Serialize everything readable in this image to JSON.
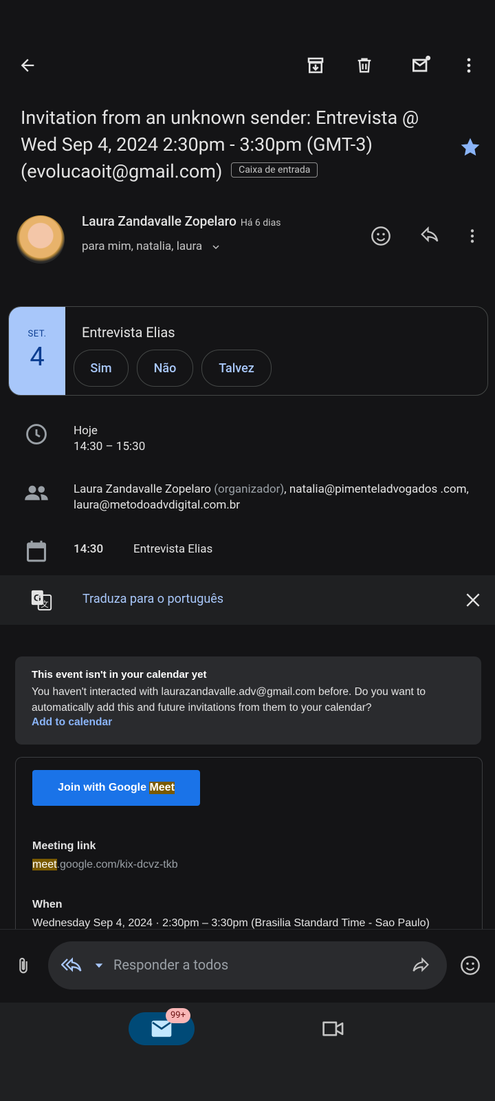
{
  "subject": {
    "text": "Invitation from an unknown sender: Entrevista @ Wed Sep 4, 2024 2:30pm - 3:30pm (GMT-3) (evolucaoit@gmail.com)",
    "label": "Caixa de entrada",
    "starred": true
  },
  "sender": {
    "name": "Laura Zandavalle Zopelaro",
    "time": "Há 6 dias",
    "recipients": "para mim, natalia, laura"
  },
  "event": {
    "month": "SET.",
    "day": "4",
    "title": "Entrevista Elias",
    "rsvp": [
      "Sim",
      "Não",
      "Talvez"
    ]
  },
  "details": {
    "when_day": "Hoje",
    "when_time": "14:30 – 15:30",
    "organizer": "Laura Zandavalle Zopelaro",
    "organizer_tag": "(organizador)",
    "guests_rest": ", natalia@pimenteladvogados .com, laura@metodoadvdigital.com.br",
    "agenda_time": "14:30",
    "agenda_title": "Entrevista Elias"
  },
  "translate": {
    "text": "Traduza para o português"
  },
  "notice": {
    "title": "This event isn't in your calendar yet",
    "body": "You haven't interacted with laurazandavalle.adv@gmail.com before. Do you want to automatically add this and future invitations from them to your calendar?",
    "action": "Add to calendar"
  },
  "meet": {
    "button_prefix": "Join with Google",
    "button_highlight": "Meet",
    "link_label": "Meeting link",
    "link_highlight": "meet",
    "link_rest": ".google.com/kix-dcvz-tkb",
    "when_label": "When",
    "when_value": "Wednesday Sep 4, 2024 · 2:30pm – 3:30pm (Brasilia Standard Time - Sao Paulo)"
  },
  "reply": {
    "placeholder": "Responder a todos"
  },
  "nav": {
    "badge": "99+"
  },
  "colors": {
    "accent": "#a8c7fa",
    "meet_button": "#1a73e8",
    "highlight": "#7a5a00"
  }
}
